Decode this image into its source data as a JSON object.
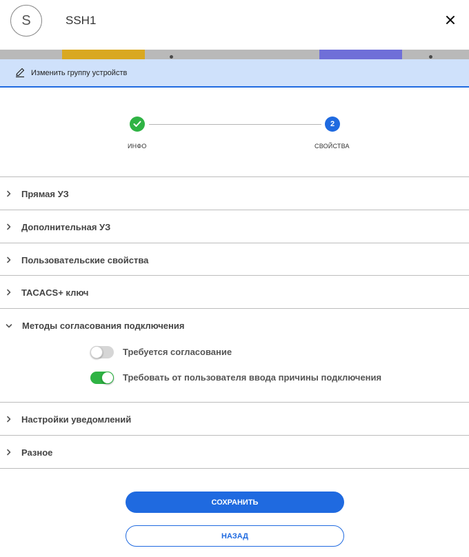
{
  "header": {
    "avatar_letter": "S",
    "title": "SSH1"
  },
  "edit_bar": {
    "label": "Изменить группу устройств"
  },
  "stepper": {
    "steps": [
      {
        "label": "ИНФО",
        "state": "done"
      },
      {
        "label": "СВОЙСТВА",
        "number": "2",
        "state": "active"
      }
    ]
  },
  "sections": [
    {
      "label": "Прямая УЗ",
      "expanded": false
    },
    {
      "label": "Дополнительная УЗ",
      "expanded": false
    },
    {
      "label": "Пользовательские свойства",
      "expanded": false
    },
    {
      "label": "TACACS+ ключ",
      "expanded": false
    },
    {
      "label": "Методы согласования подключения",
      "expanded": true
    },
    {
      "label": "Настройки уведомлений",
      "expanded": false
    },
    {
      "label": "Разное",
      "expanded": false
    }
  ],
  "toggles": [
    {
      "label": "Требуется согласование",
      "on": false
    },
    {
      "label": "Требовать от пользователя ввода причины подключения",
      "on": true
    }
  ],
  "buttons": {
    "save": "СОХРАНИТЬ",
    "back": "НАЗАД"
  },
  "colors": {
    "accent": "#1f6ae0",
    "success": "#2fb344",
    "edit_bar_bg": "#cfe1fb"
  }
}
